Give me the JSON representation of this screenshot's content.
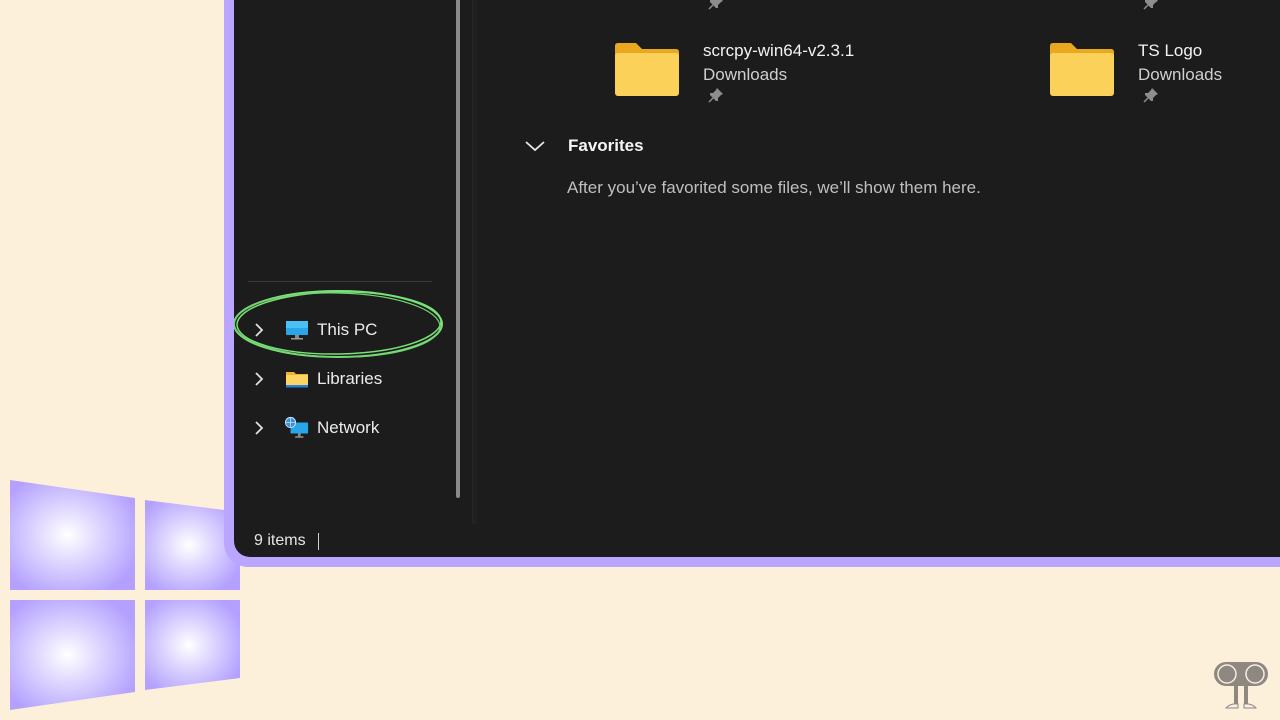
{
  "explorer": {
    "quick_access_tiles": [
      {
        "name": "scrcpy-win64-v2.3.1",
        "location": "Downloads",
        "pinned": true,
        "icon": "folder-icon"
      },
      {
        "name": "TS Logo",
        "location": "Downloads",
        "pinned": true,
        "icon": "folder-icon"
      }
    ],
    "favorites": {
      "title": "Favorites",
      "expanded": true,
      "empty_message": "After you’ve favorited some files, we’ll show them here."
    },
    "nav_pane": {
      "items": [
        {
          "label": "This PC",
          "icon": "monitor-icon",
          "expanded": false,
          "highlighted": true
        },
        {
          "label": "Libraries",
          "icon": "folder-icon",
          "expanded": false
        },
        {
          "label": "Network",
          "icon": "network-icon",
          "expanded": false
        }
      ]
    },
    "status_bar": {
      "item_count": "9 items"
    }
  },
  "colors": {
    "background": "#fdf0db",
    "frame_accent": "#bba6ff",
    "window_bg": "#1c1c1c",
    "highlight_circle": "#7be07a",
    "folder_yellow": "#f9c94a"
  }
}
